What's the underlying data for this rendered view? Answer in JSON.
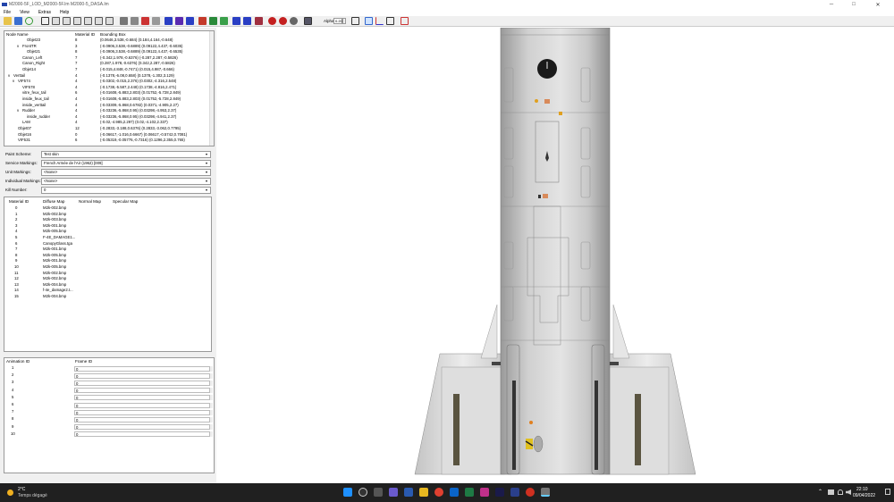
{
  "window": {
    "title": "M2000-5F_LOD_M2000-5F.lm M2000-5_DASA.lm",
    "controls": {
      "minimize": "─",
      "maximize": "□",
      "close": "✕"
    }
  },
  "menu": [
    "File",
    "View",
    "Extras",
    "Help"
  ],
  "toolbar": {
    "alpha_label": "Alpha:",
    "alpha_value": "0.20"
  },
  "node_tree": {
    "headers": {
      "node": "Node Name",
      "material": "Material ID",
      "bbox": "Bounding Box"
    },
    "rows": [
      {
        "name": "Objet23",
        "indent": 4,
        "mat": "8",
        "bbox": "(0.0646,3.538,-0.684) (0.184,4.164,-0.648)"
      },
      {
        "name": "FrontTR",
        "indent": 3,
        "exp": "v",
        "mat": "3",
        "bbox": "(-0.0906,3.538,-0.6889) (0.09122,4.437,-0.6035)"
      },
      {
        "name": "Objet21",
        "indent": 4,
        "mat": "8",
        "bbox": "(-0.0906,3.538,-0.6889) (0.09122,4.437,-0.6535)"
      },
      {
        "name": "Canon_Left",
        "indent": 3,
        "mat": "7",
        "bbox": "(-0.342,1.978,-0.6376) (-0.287,2.287,-0.5826)"
      },
      {
        "name": "Canon_Right",
        "indent": 3,
        "mat": "7",
        "bbox": "(0.287,1.978,-0.6376) (0.342,2.287,-0.5826)"
      },
      {
        "name": "Objet14",
        "indent": 3,
        "mat": "7",
        "bbox": "(-0.015,4.848,-0.7471) (0.015,4.987,-0.666)"
      },
      {
        "name": "Verttail",
        "indent": 1,
        "exp": "v",
        "mat": "4",
        "bbox": "(-0.1378,-6.08,0.658) (0.1378,-1.302,3.129)"
      },
      {
        "name": "VIF574",
        "indent": 2,
        "exp": "v",
        "mat": "4",
        "bbox": "(-0.0302,-0.015,2.376) (0.0302,-4.316,2.548)"
      },
      {
        "name": "VIF578",
        "indent": 3,
        "mat": "4",
        "bbox": "(-0.1738,-5.587,2.448) (0.1738,-4.816,2.471)"
      },
      {
        "name": "vitre_feux_tail",
        "indent": 3,
        "mat": "6",
        "bbox": "(-0.01608,-5.883,2.803) (0.01752,-5.728,2.849)"
      },
      {
        "name": "inside_feux_tail",
        "indent": 3,
        "mat": "4",
        "bbox": "(-0.01608,-5.883,2.803) (0.01752,-5.728,2.849)"
      },
      {
        "name": "inside_verttail",
        "indent": 3,
        "mat": "4",
        "bbox": "(-0.03309,-5.868,0.6782) (0.0371,-4.905,2.27)"
      },
      {
        "name": "Rudder",
        "indent": 3,
        "exp": "v",
        "mat": "4",
        "bbox": "(-0.03236,-5.868,0.95) (0.03298,-4.953,2.37)"
      },
      {
        "name": "inside_rudder",
        "indent": 4,
        "mat": "4",
        "bbox": "(-0.03236,-5.868,0.95) (0.03298,-4.941,2.37)"
      },
      {
        "name": "LAM",
        "indent": 3,
        "mat": "4",
        "bbox": "(-0.02,-4.985,2.297) (0.02,-4.102,2.337)"
      },
      {
        "name": "Objet07",
        "indent": 2,
        "mat": "12",
        "bbox": "(-0.2833,-3.188,0.6376) (0.2833,-3.062,0.7795)"
      },
      {
        "name": "Objet16",
        "indent": 2,
        "mat": "0",
        "bbox": "(-0.06617,-1.016,0.6667) (0.06617,-0.5742,0.7081)"
      },
      {
        "name": "VIF531",
        "indent": 2,
        "mat": "6",
        "bbox": "(-0.05319,-0.05776,-0.7316) (0.1296,2.355,0.765)"
      }
    ]
  },
  "props": [
    {
      "label": "Paint Scheme:",
      "value": "Test skin"
    },
    {
      "label": "Service Markings:",
      "value": "French Armée de l'Air (1962) [009]"
    },
    {
      "label": "Unit Markings:",
      "value": "<None>"
    },
    {
      "label": "Individual Markings:",
      "value": "<None>"
    },
    {
      "label": "Kill Number:",
      "value": "0"
    }
  ],
  "materials": {
    "headers": {
      "id": "Material ID",
      "diffuse": "Diffuse Map",
      "normal": "Normal Map",
      "specular": "Specular Map"
    },
    "rows": [
      {
        "id": "0",
        "diffuse": "M2k-002.bmp"
      },
      {
        "id": "1",
        "diffuse": "M2k-002.bmp"
      },
      {
        "id": "2",
        "diffuse": "M2k-003.bmp"
      },
      {
        "id": "3",
        "diffuse": "M2k-001.bmp"
      },
      {
        "id": "4",
        "diffuse": "M2k-005.bmp"
      },
      {
        "id": "5",
        "diffuse": "F-4E_DAMAGE1..."
      },
      {
        "id": "6",
        "diffuse": "CanopyGlass.tga"
      },
      {
        "id": "7",
        "diffuse": "M2k-001.bmp"
      },
      {
        "id": "8",
        "diffuse": "M2k-005.bmp"
      },
      {
        "id": "9",
        "diffuse": "M2k-001.bmp"
      },
      {
        "id": "10",
        "diffuse": "M2k-005.bmp"
      },
      {
        "id": "11",
        "diffuse": "M2k-002.bmp"
      },
      {
        "id": "12",
        "diffuse": "M2k-002.bmp"
      },
      {
        "id": "13",
        "diffuse": "M2k-004.bmp"
      },
      {
        "id": "14",
        "diffuse": "f-4e_damage2.t..."
      },
      {
        "id": "15",
        "diffuse": "M2k-004.bmp"
      }
    ]
  },
  "animations": {
    "headers": {
      "id": "Animation ID",
      "frame": "Frame ID"
    },
    "rows": [
      {
        "id": "1",
        "frame": "0"
      },
      {
        "id": "2",
        "frame": "0"
      },
      {
        "id": "3",
        "frame": "0"
      },
      {
        "id": "4",
        "frame": "0"
      },
      {
        "id": "5",
        "frame": "0"
      },
      {
        "id": "6",
        "frame": "0"
      },
      {
        "id": "7",
        "frame": "0"
      },
      {
        "id": "8",
        "frame": "0"
      },
      {
        "id": "9",
        "frame": "0"
      },
      {
        "id": "10",
        "frame": "0"
      }
    ]
  },
  "taskbar": {
    "temperature": "2°C",
    "weather": "Temps dégagé",
    "time": "22:10",
    "date": "09/04/2022"
  },
  "colors": {
    "fuselage": "#d6d6d6",
    "taskbar": "#202020",
    "accent": "#0078d4"
  }
}
